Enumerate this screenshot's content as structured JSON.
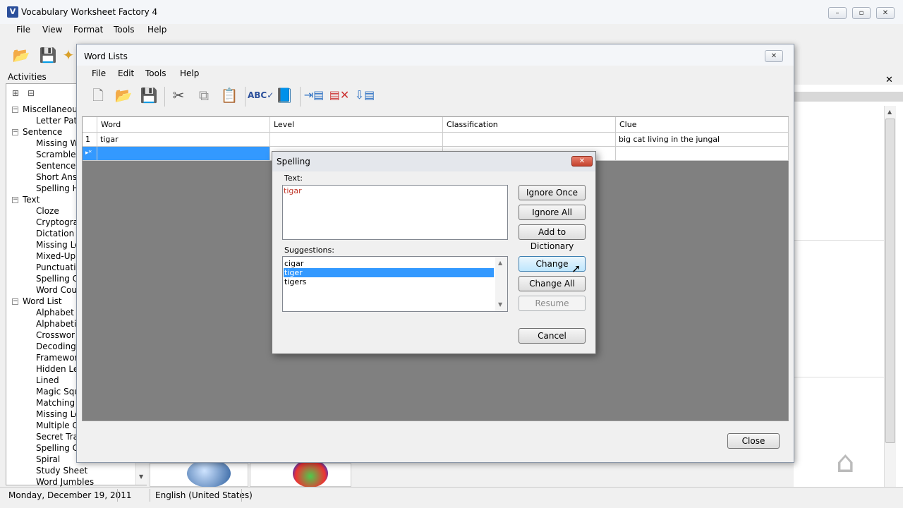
{
  "app": {
    "title": "Vocabulary Worksheet Factory 4",
    "menu": [
      "File",
      "View",
      "Format",
      "Tools",
      "Help"
    ],
    "activities_label": "Activities",
    "tree": [
      {
        "label": "Miscellaneous",
        "level": 0
      },
      {
        "label": "Letter Pat",
        "level": 1
      },
      {
        "label": "Sentence",
        "level": 0
      },
      {
        "label": "Missing W",
        "level": 1
      },
      {
        "label": "Scramble",
        "level": 1
      },
      {
        "label": "Sentence",
        "level": 1
      },
      {
        "label": "Short Ans",
        "level": 1
      },
      {
        "label": "Spelling H",
        "level": 1
      },
      {
        "label": "Text",
        "level": 0
      },
      {
        "label": "Cloze",
        "level": 1
      },
      {
        "label": "Cryptogra",
        "level": 1
      },
      {
        "label": "Dictation",
        "level": 1
      },
      {
        "label": "Missing Le",
        "level": 1
      },
      {
        "label": "Mixed-Up",
        "level": 1
      },
      {
        "label": "Punctuatio",
        "level": 1
      },
      {
        "label": "Spelling Q",
        "level": 1
      },
      {
        "label": "Word Cou",
        "level": 1
      },
      {
        "label": "Word List",
        "level": 0
      },
      {
        "label": "Alphabet S",
        "level": 1
      },
      {
        "label": "Alphabetic",
        "level": 1
      },
      {
        "label": "Crosswor",
        "level": 1
      },
      {
        "label": "Decoding",
        "level": 1
      },
      {
        "label": "Framewor",
        "level": 1
      },
      {
        "label": "Hidden Le",
        "level": 1
      },
      {
        "label": "Lined",
        "level": 1
      },
      {
        "label": "Magic Squ",
        "level": 1
      },
      {
        "label": "Matching",
        "level": 1
      },
      {
        "label": "Missing Le",
        "level": 1
      },
      {
        "label": "Multiple C",
        "level": 1
      },
      {
        "label": "Secret Tra",
        "level": 1
      },
      {
        "label": "Spelling C",
        "level": 1
      },
      {
        "label": "Spiral",
        "level": 1
      },
      {
        "label": "Study Sheet",
        "level": 1
      },
      {
        "label": "Word Jumbles",
        "level": 1
      }
    ],
    "status": {
      "date": "Monday, December 19, 2011",
      "language": "English (United States)"
    }
  },
  "word_lists": {
    "title": "Word Lists",
    "menu": [
      "File",
      "Edit",
      "Tools",
      "Help"
    ],
    "columns": [
      "Word",
      "Level",
      "Classification",
      "Clue"
    ],
    "rows": [
      {
        "num": "1",
        "word": "tigar",
        "level": "",
        "classification": "",
        "clue": "big cat living in the jungal"
      }
    ],
    "new_row_marker": "▸*",
    "close_label": "Close"
  },
  "spelling": {
    "title": "Spelling",
    "text_label": "Text:",
    "text_value": "tigar",
    "suggestions_label": "Suggestions:",
    "suggestions": [
      "cigar",
      "tiger",
      "tigers"
    ],
    "selected_suggestion": "tiger",
    "buttons": {
      "ignore_once": "Ignore Once",
      "ignore_all": "Ignore All",
      "add_to_dictionary": "Add to Dictionary",
      "change": "Change",
      "change_all": "Change All",
      "resume": "Resume",
      "cancel": "Cancel"
    }
  }
}
